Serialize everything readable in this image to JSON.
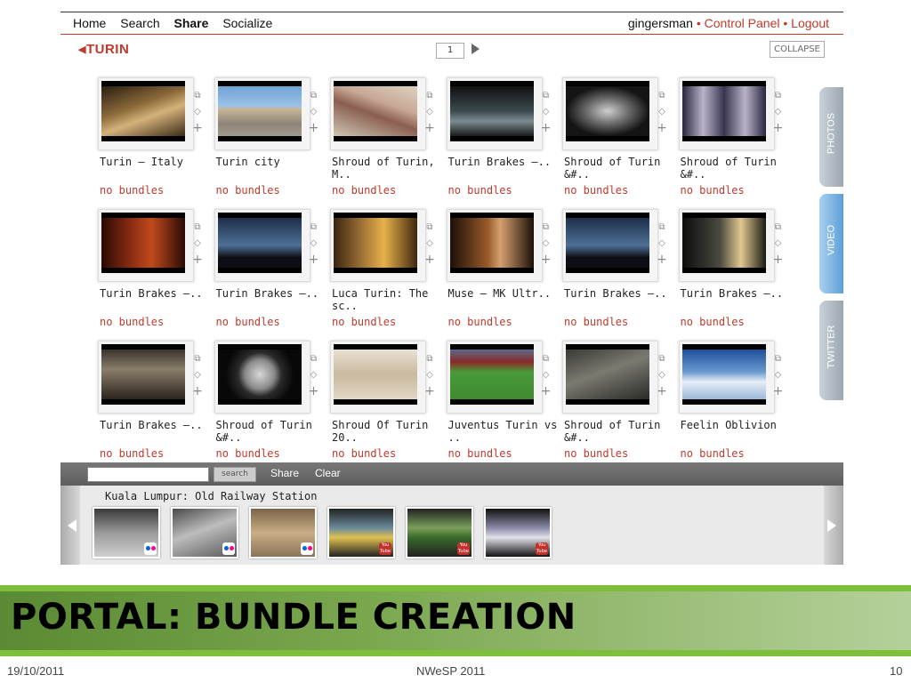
{
  "nav": {
    "items": [
      "Home",
      "Search",
      "Share",
      "Socialize"
    ],
    "active": "Share",
    "user": "gingersman",
    "sep": " • ",
    "control_panel": "Control Panel",
    "logout": "Logout"
  },
  "location": {
    "back_arrow": "◀",
    "label": "TURIN"
  },
  "pager": {
    "page": "1"
  },
  "collapse_label": "COLLAPSE",
  "items": [
    {
      "title": "Turin – Italy",
      "status": "no bundles",
      "thumb": "stairs"
    },
    {
      "title": "Turin city",
      "status": "no bundles",
      "thumb": "palace"
    },
    {
      "title": "Shroud of Turin, M..",
      "status": "no bundles",
      "thumb": "shroud-leg"
    },
    {
      "title": "Turin Brakes –..",
      "status": "no bundles",
      "thumb": "car"
    },
    {
      "title": "Shroud of Turin &#..",
      "status": "no bundles",
      "thumb": "shroud-face"
    },
    {
      "title": "Shroud of Turin &#..",
      "status": "no bundles",
      "thumb": "shroud-full"
    },
    {
      "title": "Turin Brakes –..",
      "status": "no bundles",
      "thumb": "red-room"
    },
    {
      "title": "Turin Brakes –..",
      "status": "no bundles",
      "thumb": "night-sky"
    },
    {
      "title": "Luca Turin: The sc..",
      "status": "no bundles",
      "thumb": "speaker"
    },
    {
      "title": "Muse – MK Ultr..",
      "status": "no bundles",
      "thumb": "singer"
    },
    {
      "title": "Turin Brakes –..",
      "status": "no bundles",
      "thumb": "night-sky"
    },
    {
      "title": "Turin Brakes –..",
      "status": "no bundles",
      "thumb": "man-dark"
    },
    {
      "title": "Turin Brakes –..",
      "status": "no bundles",
      "thumb": "ruins"
    },
    {
      "title": "Shroud of Turin &#..",
      "status": "no bundles",
      "thumb": "sphere"
    },
    {
      "title": "Shroud Of Turin 20..",
      "status": "no bundles",
      "thumb": "torso"
    },
    {
      "title": "Juventus Turin vs ..",
      "status": "no bundles",
      "thumb": "football"
    },
    {
      "title": "Shroud of Turin &#..",
      "status": "no bundles",
      "thumb": "aerial"
    },
    {
      "title": "Feelin Oblivion",
      "status": "no bundles",
      "thumb": "clouds"
    }
  ],
  "side_tabs": [
    "PHOTOS",
    "VIDEO",
    "TWITTER"
  ],
  "search": {
    "button": "search",
    "share": "Share",
    "clear": "Clear"
  },
  "bundle": {
    "title": "Kuala Lumpur: Old Railway Station",
    "thumbs": [
      {
        "source": "flickr"
      },
      {
        "source": "flickr"
      },
      {
        "source": "flickr"
      },
      {
        "source": "youtube",
        "label": "You Tube"
      },
      {
        "source": "youtube",
        "label": "You Tube"
      },
      {
        "source": "youtube",
        "label": "You Tube"
      }
    ]
  },
  "slide": {
    "title": "PORTAL: BUNDLE CREATION",
    "date": "19/10/2011",
    "event": "NWeSP 2011",
    "page": "10"
  },
  "colors": {
    "accent_red": "#c0392b",
    "band_green": "#7dbf3a",
    "tab_blue": "#6aa6d8",
    "tab_gray": "#a9b4bd"
  }
}
